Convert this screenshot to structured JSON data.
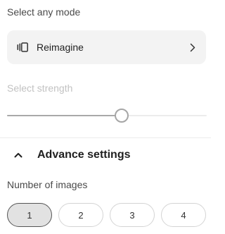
{
  "mode_section": {
    "label": "Select any mode",
    "selected_mode": "Reimagine",
    "icon": "carousel-icon",
    "chevron_icon": "chevron-right-icon"
  },
  "strength_section": {
    "label": "Select strength",
    "disabled": true,
    "value_fraction": 0.57
  },
  "advance_settings": {
    "title": "Advance settings",
    "expanded": true,
    "chevron_icon": "chevron-up-icon"
  },
  "image_count": {
    "label": "Number of images",
    "options": [
      "1",
      "2",
      "3",
      "4"
    ],
    "selected": "1"
  },
  "colors": {
    "selected_option_bg": "#e2e2e2",
    "select_bg": "#f3f3f3",
    "disabled_label": "#c2c2c2"
  }
}
